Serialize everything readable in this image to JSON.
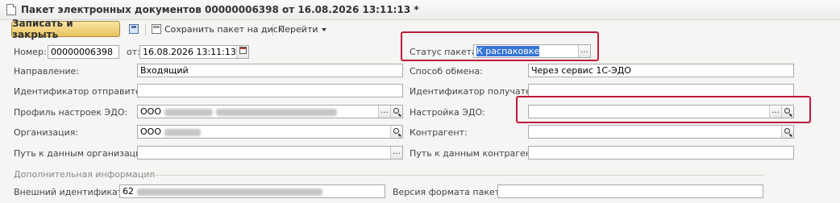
{
  "window": {
    "title": "Пакет электронных документов 00000006398 от 16.08.2026 13:11:13 *"
  },
  "toolbar": {
    "save_close_label": "Записать и закрыть",
    "save_to_disk_label": "Сохранить пакет на диск",
    "goto_label": "Перейти"
  },
  "form": {
    "number_label": "Номер:",
    "number_value": "00000006398",
    "date_label": "от:",
    "date_value": "16.08.2026 13:11:13",
    "status_label": "Статус пакета:",
    "status_value": "К распаковке",
    "direction_label": "Направление:",
    "direction_value": "Входящий",
    "exchange_method_label": "Способ обмена:",
    "exchange_method_value": "Через сервис 1С-ЭДО",
    "sender_id_label": "Идентификатор отправителя:",
    "sender_id_value": "",
    "receiver_id_label": "Идентификатор получателя:",
    "receiver_id_value": "",
    "edo_profile_label": "Профиль настроек ЭДО:",
    "edo_profile_value": "ООО",
    "edo_setting_label": "Настройка ЭДО:",
    "edo_setting_value": "",
    "organization_label": "Организация:",
    "organization_value": "ООО",
    "counterparty_label": "Контрагент:",
    "counterparty_value": "",
    "org_path_label": "Путь к данным организации:",
    "org_path_value": "",
    "counterparty_path_label": "Путь к данным контрагента:",
    "counterparty_path_value": "",
    "additional_info_title": "Дополнительная информация",
    "external_id_label": "Внешний идентификатор:",
    "external_id_value": "62",
    "package_format_label": "Версия формата пакета:",
    "package_format_value": ""
  },
  "colors": {
    "highlight_red": "#c0193a",
    "selection_blue": "#3875d7",
    "primary_button": "#e8c25e"
  }
}
